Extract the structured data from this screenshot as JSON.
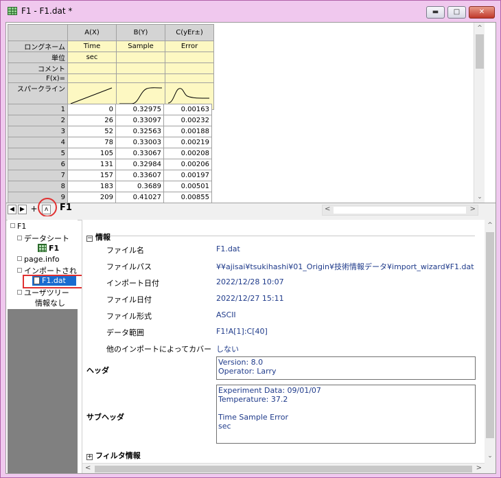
{
  "window": {
    "title": "F1 - F1.dat *"
  },
  "columns": [
    {
      "header": "A(X)",
      "long_name": "Time",
      "unit": "sec",
      "comment": "",
      "fx": ""
    },
    {
      "header": "B(Y)",
      "long_name": "Sample",
      "unit": "",
      "comment": "",
      "fx": ""
    },
    {
      "header": "C(yEr±)",
      "long_name": "Error",
      "unit": "",
      "comment": "",
      "fx": ""
    }
  ],
  "row_labels": {
    "long_name": "ロングネーム",
    "unit": "単位",
    "comment": "コメント",
    "fx": "F(x)=",
    "sparkline": "スパークライン"
  },
  "rows": [
    [
      "1",
      "0",
      "0.32975",
      "0.00163"
    ],
    [
      "2",
      "26",
      "0.33097",
      "0.00232"
    ],
    [
      "3",
      "52",
      "0.32563",
      "0.00188"
    ],
    [
      "4",
      "78",
      "0.33003",
      "0.00219"
    ],
    [
      "5",
      "105",
      "0.33067",
      "0.00208"
    ],
    [
      "6",
      "131",
      "0.32984",
      "0.00206"
    ],
    [
      "7",
      "157",
      "0.33607",
      "0.00197"
    ],
    [
      "8",
      "183",
      "0.3689",
      "0.00501"
    ],
    [
      "9",
      "209",
      "0.41027",
      "0.00855"
    ]
  ],
  "tabs": {
    "nav_add": "+",
    "nav_up": "ʌ",
    "sheet_name": "F1"
  },
  "tree": {
    "root": "F1",
    "datasheet": "データシート",
    "sheet_f1": "F1",
    "page_info": "page.info",
    "imported": "インポートされた",
    "file_f1dat": "F1.dat",
    "user": "ユーザツリー",
    "no_info": "情報なし"
  },
  "info": {
    "section_title": "情報",
    "fields": [
      {
        "label": "ファイル名",
        "value": "F1.dat"
      },
      {
        "label": "ファイルパス",
        "value": "¥¥ajisai¥tsukihashi¥01_Origin¥技術情報データ¥import_wizard¥F1.dat"
      },
      {
        "label": "インポート日付",
        "value": "2022/12/28 10:07"
      },
      {
        "label": "ファイル日付",
        "value": "2022/12/27 15:11"
      },
      {
        "label": "ファイル形式",
        "value": "ASCII"
      },
      {
        "label": "データ範囲",
        "value": "F1!A[1]:C[40]"
      },
      {
        "label": "他のインポートによってカバー",
        "value": "しない"
      }
    ],
    "header_label": "ヘッダ",
    "header_text": "Version: 8.0\nOperator: Larry",
    "subheader_label": "サブヘッダ",
    "subheader_text": "Experiment Data: 09/01/07\nTemperature: 37.2\n\nTime Sample Error\nsec",
    "filter_label": "フィルタ情報"
  },
  "icons": [
    "worksheet-grid-icon",
    "minimize-icon",
    "maximize-icon",
    "close-icon",
    "document-icon"
  ],
  "colors": {
    "accent_selected": "#1a6cd0",
    "metadata_rows": "#fdf8c2",
    "highlight_markup": "#e03030",
    "value_text": "#1e3a8a"
  }
}
